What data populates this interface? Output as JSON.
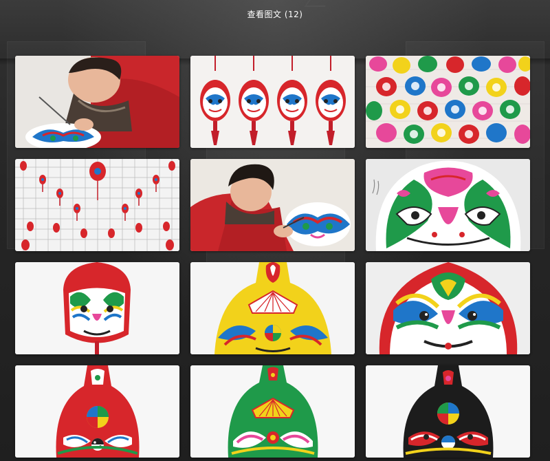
{
  "header": {
    "title": "查看图文 (12)"
  },
  "gallery": {
    "images": [
      {
        "name": "artisan-painting-gourd",
        "icon": "photo-artisan"
      },
      {
        "name": "four-hanging-gourds",
        "icon": "photo-hanging-gourds"
      },
      {
        "name": "gourd-wall-display",
        "icon": "photo-wall-display"
      },
      {
        "name": "gourds-on-grid-wall",
        "icon": "photo-grid-wall"
      },
      {
        "name": "artisan-painting-closeup",
        "icon": "photo-artisan"
      },
      {
        "name": "mask-closeup-green-pink",
        "icon": "photo-mask"
      },
      {
        "name": "mask-rainbow-small",
        "icon": "photo-mask"
      },
      {
        "name": "mask-yellow-fan",
        "icon": "photo-mask"
      },
      {
        "name": "mask-rainbow-large",
        "icon": "photo-mask"
      },
      {
        "name": "gourd-red-taiji",
        "icon": "photo-gourd"
      },
      {
        "name": "gourd-green-fan",
        "icon": "photo-gourd"
      },
      {
        "name": "gourd-black-taiji",
        "icon": "photo-gourd"
      }
    ]
  },
  "colors": {
    "overlay_bg": "#262626",
    "title_text": "#ffffff",
    "thumb_red": "#d7262b",
    "thumb_green": "#1f9a4a",
    "thumb_yellow": "#f2d21b",
    "thumb_blue": "#1f76c9",
    "thumb_pink": "#e7489a"
  }
}
